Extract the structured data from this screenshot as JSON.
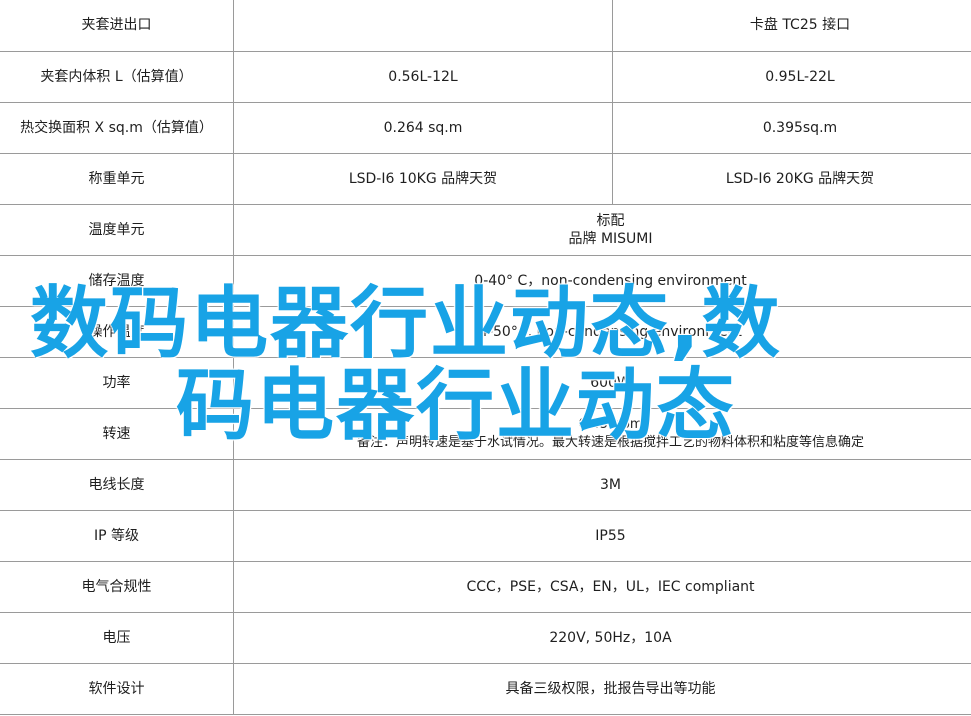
{
  "rows": [
    {
      "label": "夹套进出口",
      "merged": false,
      "a": "",
      "b": "卡盘 TC25 接口"
    },
    {
      "label": "夹套内体积 L（估算值）",
      "merged": false,
      "a": "0.56L-12L",
      "b": "0.95L-22L"
    },
    {
      "label": "热交换面积 X sq.m（估算值）",
      "merged": false,
      "a": "0.264 sq.m",
      "b": "0.395sq.m"
    },
    {
      "label": "称重单元",
      "merged": false,
      "a": "LSD-I6 10KG 品牌天贺",
      "b": "LSD-I6 20KG 品牌天贺"
    },
    {
      "label": "温度单元",
      "merged": true,
      "lines": [
        "标配",
        "品牌 MISUMI"
      ]
    },
    {
      "label": "储存温度",
      "merged": true,
      "lines": [
        "0-40° C，non-condensing environment"
      ]
    },
    {
      "label": "操作温度",
      "merged": true,
      "lines": [
        "4-50°C, non-condensing environment"
      ]
    },
    {
      "label": "功率",
      "merged": true,
      "lines": [
        "600W"
      ]
    },
    {
      "label": "转速",
      "merged": true,
      "lines": [
        "0-450rpm",
        "备注：声明转速是基于水试情况。最大转速是根据搅拌工艺的物料体积和粘度等信息确定"
      ]
    },
    {
      "label": "电线长度",
      "merged": true,
      "lines": [
        "3M"
      ]
    },
    {
      "label": "IP 等级",
      "merged": true,
      "lines": [
        "IP55"
      ]
    },
    {
      "label": "电气合规性",
      "merged": true,
      "lines": [
        "CCC，PSE，CSA，EN，UL，IEC compliant"
      ]
    },
    {
      "label": "电压",
      "merged": true,
      "lines": [
        "220V, 50Hz，10A"
      ]
    },
    {
      "label": "软件设计",
      "merged": true,
      "lines": [
        "具备三级权限，批报告导出等功能"
      ]
    }
  ],
  "overlay": {
    "line1": "数码电器行业动态,数",
    "line2": "码电器行业动态",
    "color": "#18a3e6"
  }
}
